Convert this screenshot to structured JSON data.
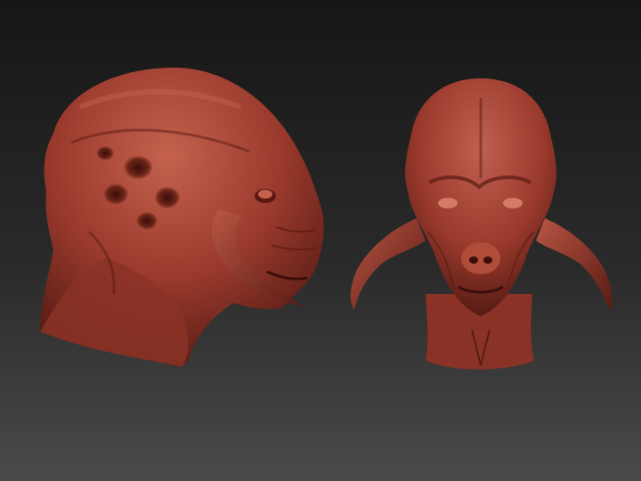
{
  "scene": {
    "background_top": "#161616",
    "background_bottom": "#4a4a4a",
    "material_color": "#9a3a2c",
    "material_highlight": "#c4624f",
    "material_shadow": "#4a1510"
  },
  "models": [
    {
      "view": "side"
    },
    {
      "view": "front"
    }
  ]
}
